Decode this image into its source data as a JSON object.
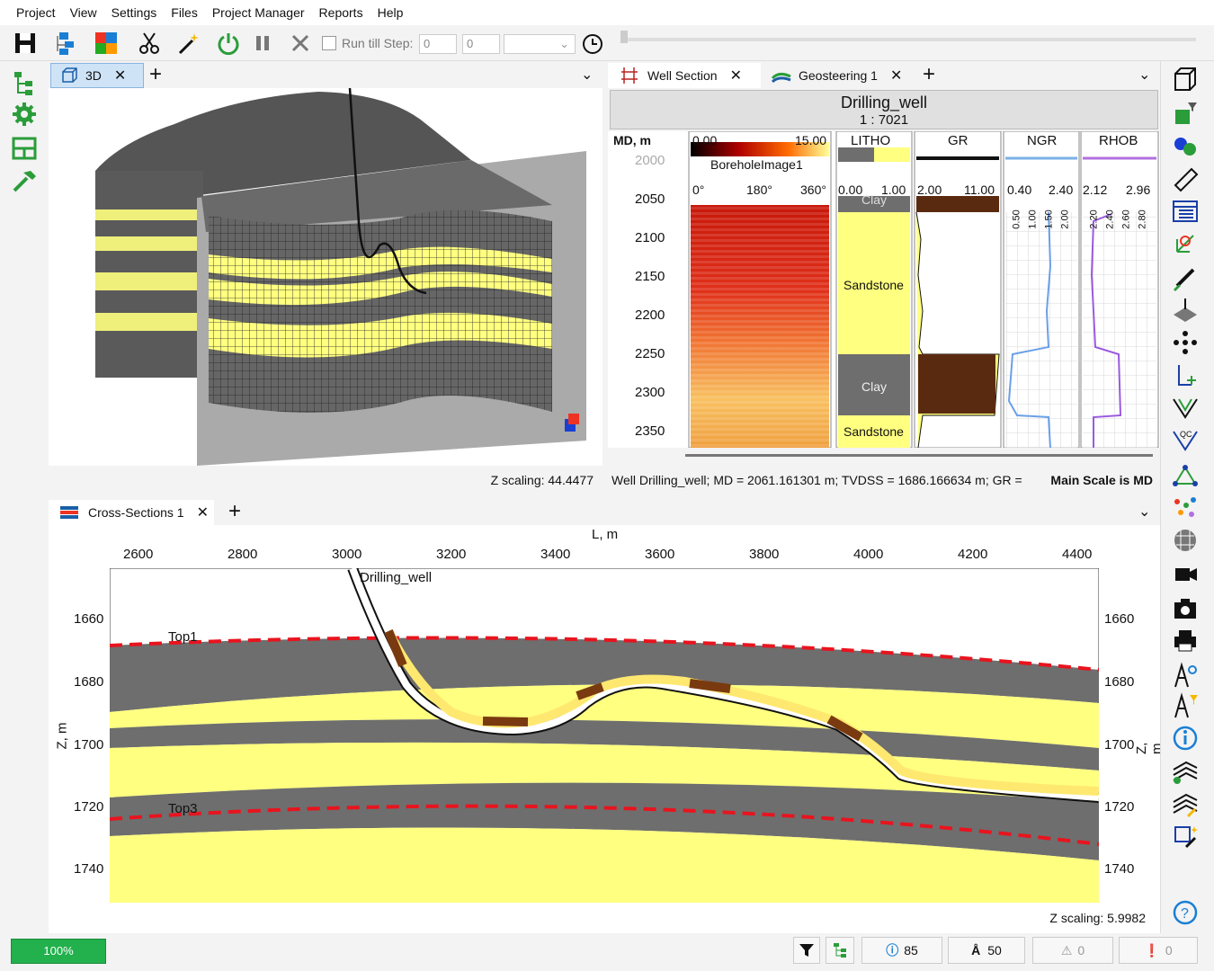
{
  "menu": [
    "Project",
    "View",
    "Settings",
    "Files",
    "Project Manager",
    "Reports",
    "Help"
  ],
  "toolbar": {
    "run_till_step_label": "Run till Step:",
    "step_a": "0",
    "step_b": "0"
  },
  "panel3d": {
    "tab_label": "3D",
    "z_scaling": "Z scaling: 44.4477"
  },
  "wellsection": {
    "tab_label": "Well Section",
    "tab2_label": "Geosteering 1",
    "well_name": "Drilling_well",
    "scale": "1 : 7021",
    "md_header": "MD, m",
    "md_ticks": [
      "2000",
      "2050",
      "2100",
      "2150",
      "2200",
      "2250",
      "2300",
      "2350"
    ],
    "image_track": {
      "min": "0.00",
      "max": "15.00",
      "name": "BoreholeImage1",
      "deg0": "0°",
      "deg180": "180°",
      "deg360": "360°"
    },
    "litho_track": {
      "name": "LITHO",
      "min": "0.00",
      "max": "1.00",
      "units": [
        {
          "name": "Clay"
        },
        {
          "name": "Sandstone"
        },
        {
          "name": "Clay"
        },
        {
          "name": "Sandstone"
        }
      ]
    },
    "gr_track": {
      "name": "GR",
      "min": "2.00",
      "max": "11.00"
    },
    "ngr_track": {
      "name": "NGR",
      "min": "0.40",
      "max": "2.40",
      "ticks": [
        "0.50",
        "1.00",
        "1.50",
        "2.00"
      ]
    },
    "rhob_track": {
      "name": "RHOB",
      "min": "2.12",
      "max": "2.96",
      "ticks": [
        "2.20",
        "2.40",
        "2.60",
        "2.80"
      ]
    },
    "status_text": "Well Drilling_well; MD = 2061.161301 m; TVDSS = 1686.166634 m; GR =",
    "main_scale": "Main Scale is MD"
  },
  "crosssection": {
    "tab_label": "Cross-Sections 1",
    "x_axis_label": "L, m",
    "y_axis_label": "Z, m",
    "y_axis_label_right": "Z, m",
    "x_ticks": [
      "2600",
      "2800",
      "3000",
      "3200",
      "3400",
      "3600",
      "3800",
      "4000",
      "4200",
      "4400"
    ],
    "y_ticks": [
      "1660",
      "1680",
      "1700",
      "1720",
      "1740"
    ],
    "well_label": "Drilling_well",
    "top1_label": "Top1",
    "top3_label": "Top3",
    "z_scaling": "Z scaling: 5.9982"
  },
  "statusbar": {
    "progress": "100%",
    "info_count": "85",
    "well_count": "50",
    "warn_count": "0",
    "error_count": "0"
  },
  "colors": {
    "accent": "#1a7fd4",
    "progress": "#22b14c",
    "sand": "#ffff80",
    "clay": "#6e6e6e",
    "top_line": "#e8141e"
  }
}
